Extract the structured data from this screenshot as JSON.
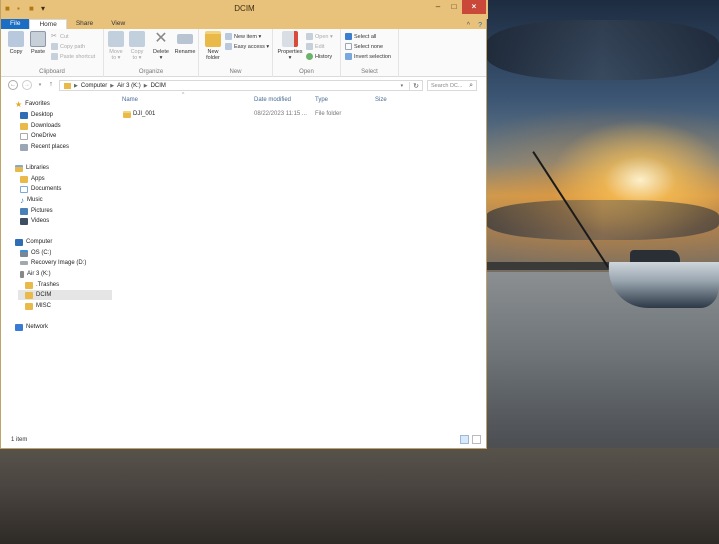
{
  "window": {
    "title": "DCIM",
    "controls": {
      "minimize": "–",
      "maximize": "□",
      "close": "×"
    }
  },
  "ribbon": {
    "tabs": [
      {
        "label": "File"
      },
      {
        "label": "Home"
      },
      {
        "label": "Share"
      },
      {
        "label": "View"
      }
    ],
    "help": "?",
    "collapse": "^",
    "clipboard": {
      "label": "Clipboard",
      "copy": "Copy",
      "paste": "Paste",
      "cut": "Cut",
      "copy_path": "Copy path",
      "paste_shortcut": "Paste shortcut"
    },
    "organize": {
      "label": "Organize",
      "move_to": "Move",
      "move_to_2": "to ▾",
      "copy_to": "Copy",
      "copy_to_2": "to ▾",
      "delete": "Delete",
      "delete_2": "▾",
      "rename": "Rename"
    },
    "new": {
      "label": "New",
      "new_folder": "New",
      "new_folder_2": "folder",
      "new_item": "New item ▾",
      "easy_access": "Easy access ▾"
    },
    "open": {
      "label": "Open",
      "properties": "Properties",
      "properties_2": "▾",
      "open": "Open ▾",
      "edit": "Edit",
      "history": "History"
    },
    "select": {
      "label": "Select",
      "select_all": "Select all",
      "select_none": "Select none",
      "invert": "Invert selection"
    }
  },
  "address": {
    "crumbs": [
      "Computer",
      "Air 3 (K:)",
      "DCIM"
    ],
    "search_placeholder": "Search DC..."
  },
  "navpane": {
    "favorites": {
      "header": "Favorites",
      "items": [
        "Desktop",
        "Downloads",
        "OneDrive",
        "Recent places"
      ]
    },
    "libraries": {
      "header": "Libraries",
      "items": [
        "Apps",
        "Documents",
        "Music",
        "Pictures",
        "Videos"
      ]
    },
    "computer": {
      "header": "Computer",
      "items": [
        "OS (C:)",
        "Recovery Image (D:)",
        "Air 3 (K:)"
      ],
      "subitems": [
        ".Trashes",
        "DCIM",
        "MISC"
      ]
    },
    "network": {
      "header": "Network"
    }
  },
  "columns": [
    "Name",
    "Date modified",
    "Type",
    "Size"
  ],
  "files": [
    {
      "name": "DJI_001",
      "date": "08/22/2023 11:15 ...",
      "type": "File folder",
      "size": ""
    }
  ],
  "status": {
    "count": "1 item"
  },
  "colors": {
    "titlebar": "#e8c27b",
    "file_tab": "#1c6dc4",
    "close": "#c9483a",
    "folder": "#e9b94a"
  }
}
